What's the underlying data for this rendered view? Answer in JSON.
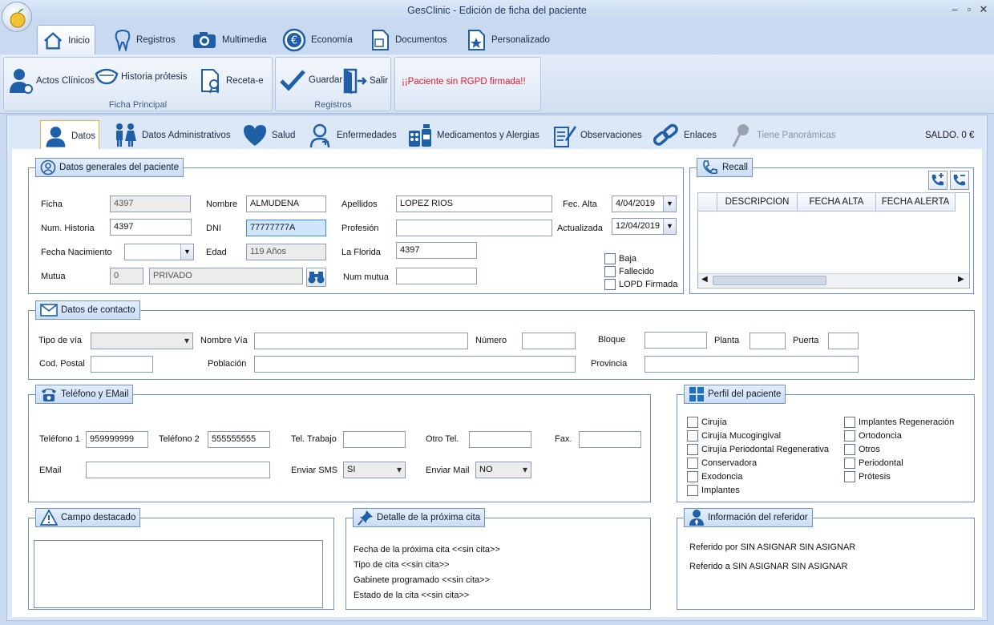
{
  "window": {
    "title": "GesClinic - Edición de ficha del paciente"
  },
  "ribbon_tabs": [
    "Inicio",
    "Registros",
    "Multimedia",
    "Economía",
    "Documentos",
    "Personalizado"
  ],
  "ribbon": {
    "ficha_principal": {
      "label": "Ficha Principal",
      "actos": "Actos Clínicos",
      "historia": "Historia prótesis",
      "receta": "Receta-e"
    },
    "registros": {
      "label": "Registros",
      "guardar": "Guardar",
      "salir": "Salir"
    },
    "warning": "¡¡Paciente sin RGPD firmada!!"
  },
  "sub_tabs": [
    "Datos",
    "Datos Administrativos",
    "Salud",
    "Enfermedades",
    "Medicamentos y Alergias",
    "Observaciones",
    "Enlaces",
    "Tiene Panorámicas"
  ],
  "saldo": "SALDO. 0 €",
  "general": {
    "title": "Datos generales del paciente",
    "ficha_label": "Ficha",
    "ficha": "4397",
    "num_historia_label": "Num. Historia",
    "num_historia": "4397",
    "fecha_nac_label": "Fecha Nacimiento",
    "fecha_nac": "",
    "mutua_label": "Mutua",
    "mutua_code": "0",
    "mutua_name": "PRIVADO",
    "nombre_label": "Nombre",
    "nombre": "ALMUDENA",
    "dni_label": "DNI",
    "dni": "77777777A",
    "edad_label": "Edad",
    "edad": "119 Años",
    "apellidos_label": "Apellidos",
    "apellidos": "LOPEZ RIOS",
    "profesion_label": "Profesión",
    "profesion": "",
    "florida_label": "La Florida",
    "florida": "4397",
    "num_mutua_label": "Num mutua",
    "num_mutua": "",
    "fec_alta_label": "Fec. Alta",
    "fec_alta": "4/04/2019",
    "actualizada_label": "Actualizada",
    "actualizada": "12/04/2019",
    "baja": "Baja",
    "fallecido": "Fallecido",
    "lopd": "LOPD Firmada"
  },
  "recall": {
    "title": "Recall",
    "columns": [
      "DESCRIPCION",
      "FECHA ALTA",
      "FECHA ALERTA"
    ]
  },
  "contacto": {
    "title": "Datos de contacto",
    "tipo_via_label": "Tipo de vía",
    "tipo_via": "",
    "nombre_via_label": "Nombre Vía",
    "nombre_via": "",
    "numero_label": "Número",
    "numero": "",
    "bloque_label": "Bloque",
    "bloque": "",
    "planta_label": "Planta",
    "planta": "",
    "puerta_label": "Puerta",
    "puerta": "",
    "cp_label": "Cod. Postal",
    "cp": "",
    "poblacion_label": "Población",
    "poblacion": "",
    "provincia_label": "Provincia",
    "provincia": ""
  },
  "telefono": {
    "title": "Teléfono y  EMail",
    "tel1_label": "Teléfono 1",
    "tel1": "959999999",
    "tel2_label": "Teléfono 2",
    "tel2": "555555555",
    "trabajo_label": "Tel. Trabajo",
    "trabajo": "",
    "otro_label": "Otro Tel.",
    "otro": "",
    "fax_label": "Fax.",
    "fax": "",
    "email_label": "EMail",
    "email": "",
    "sms_label": "Enviar SMS",
    "sms": "SI",
    "mail_label": "Enviar Mail",
    "mail": "NO"
  },
  "perfil": {
    "title": "Perfil del paciente",
    "col1": [
      "Cirujía",
      "Cirujía Mucogingival",
      "Cirujía Periodontal Regenerativa",
      "Conservadora",
      "Exodoncia",
      "Implantes"
    ],
    "col2": [
      "Implantes Regeneración",
      "Ortodoncia",
      "Otros",
      "Periodontal",
      "Prótesis"
    ]
  },
  "destacado": {
    "title": "Campo destacado",
    "text": ""
  },
  "cita": {
    "title": "Detalle de la próxima cita",
    "fecha": "Fecha de la próxima cita <<sin cita>>",
    "tipo": "Tipo de cita <<sin cita>>",
    "gabinete": "Gabinete programado <<sin cita>>",
    "estado": "Estado de la cita <<sin cita>>"
  },
  "referidor": {
    "title": "Información del referidor",
    "por": "Referido por SIN ASIGNAR SIN ASIGNAR",
    "a": "Referido a SIN ASIGNAR SIN ASIGNAR"
  },
  "colors": {
    "accent": "#1f6fc5",
    "warning": "#e01b2b",
    "panel_border": "#6f91bd"
  }
}
